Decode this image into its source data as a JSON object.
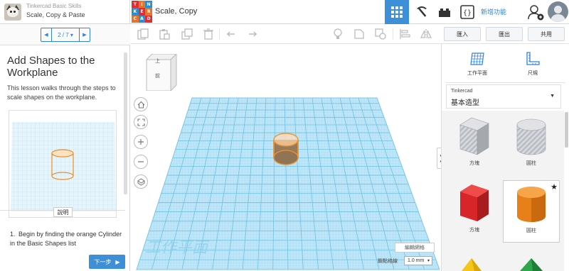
{
  "lesson": {
    "course": "Tinkercad Basic Skills",
    "name": "Scale, Copy & Paste",
    "pager": "2 / 7",
    "title": "Add Shapes to the Workplane",
    "description": "This lesson walks through the steps to scale shapes on the workplane.",
    "explain_label": "說明",
    "step_number": "1.",
    "step_text": "Begin by finding the orange Cylinder in the Basic Shapes list",
    "next_label": "下一步"
  },
  "header": {
    "logo_letters": [
      "TIN",
      "KER",
      "CAD"
    ],
    "doc_title": "Scale, Copy",
    "new_features": "新增功能"
  },
  "toolbar": {
    "import": "匯入",
    "export": "匯出",
    "share": "共用"
  },
  "workspace": {
    "viewcube_top": "上",
    "viewcube_front": "前",
    "watermark": "工作平面",
    "edit_grid": "編輯網格",
    "snap_label": "鎖點格線",
    "snap_value": "1.0 mm"
  },
  "shapes_panel": {
    "workplane_label": "工作平面",
    "ruler_label": "尺規",
    "library_small": "Tinkercad",
    "library_name": "基本造型",
    "shapes": [
      {
        "label": "方塊",
        "icon": "box-striped"
      },
      {
        "label": "圓柱",
        "icon": "cylinder-striped"
      },
      {
        "label": "方塊",
        "icon": "box-red"
      },
      {
        "label": "圓柱",
        "icon": "cylinder-orange"
      }
    ]
  },
  "colors": {
    "accent": "#3d8fd8",
    "grid": "#8fd0ec",
    "orange": "#f08c1c",
    "red": "#d8252a"
  }
}
